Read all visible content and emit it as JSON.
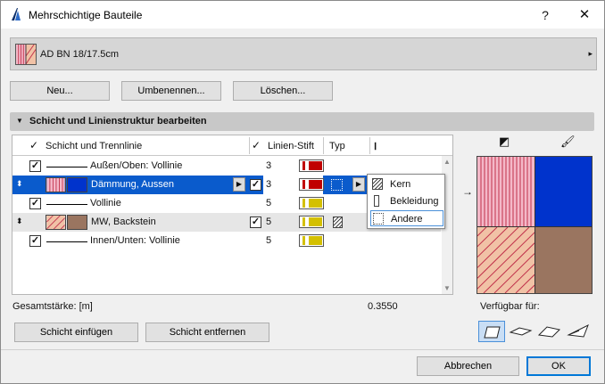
{
  "window": {
    "title": "Mehrschichtige Bauteile",
    "help_label": "?",
    "close_label": "✕"
  },
  "selector": {
    "label": "AD BN 18/17.5cm",
    "arrow": "▸"
  },
  "top_buttons": {
    "new": "Neu...",
    "rename": "Umbenennen...",
    "delete": "Löschen..."
  },
  "section": {
    "arrow": "▼",
    "title": "Schicht und Linienstruktur bearbeiten"
  },
  "table": {
    "headers": {
      "layer_line": "Schicht und Trennlinie",
      "pen": "Linien-Stift",
      "type": "Typ",
      "thickness_icon": "Ⅰ"
    },
    "header_check": "✓",
    "rows": [
      {
        "kind": "line",
        "checked": true,
        "label": "Außen/Oben: Vollinie",
        "pen": "3",
        "pen_color": "#c00000"
      },
      {
        "kind": "layer",
        "selected": true,
        "label": "Dämmung, Aussen",
        "pen": "3",
        "pen_color": "#c00000",
        "checked": true
      },
      {
        "kind": "line",
        "checked": true,
        "label": "Vollinie",
        "pen": "5",
        "pen_color": "#d4c000"
      },
      {
        "kind": "layer",
        "label": "MW, Backstein",
        "pen": "5",
        "pen_color": "#d4c000",
        "checked": true
      },
      {
        "kind": "line",
        "checked": true,
        "label": "Innen/Unten: Vollinie",
        "pen": "5",
        "pen_color": "#d4c000"
      }
    ]
  },
  "type_popup": {
    "items": [
      {
        "label": "Kern",
        "icon": "core-icon"
      },
      {
        "label": "Bekleidung",
        "icon": "finish-icon"
      },
      {
        "label": "Andere",
        "icon": "other-icon"
      }
    ]
  },
  "summary": {
    "label": "Gesamtstärke: [m]",
    "value": "0.3550"
  },
  "bottom_buttons": {
    "insert": "Schicht einfügen",
    "remove": "Schicht entfernen"
  },
  "available": {
    "label": "Verfügbar für:"
  },
  "dialog_buttons": {
    "cancel": "Abbrechen",
    "ok": "OK"
  },
  "colors": {
    "selection": "#0a5bcc",
    "insulation_fill": "#f4b8c8",
    "brick_fill": "#f1c2a6",
    "hatch_red": "#c0304a",
    "blue_fill": "#0033cc",
    "brown_fill": "#9a7560"
  }
}
